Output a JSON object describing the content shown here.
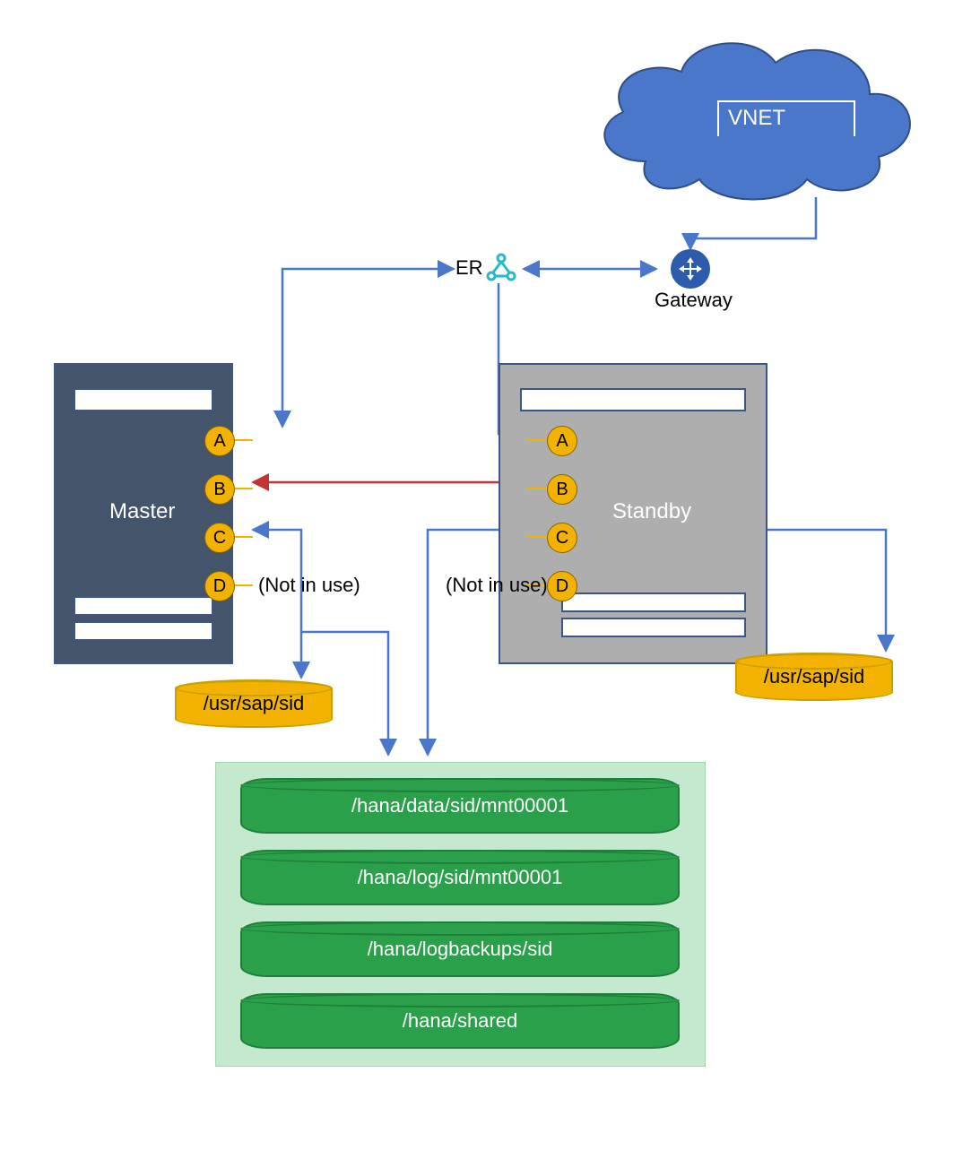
{
  "cloud": {
    "label": "VNET"
  },
  "gateway": {
    "label": "Gateway"
  },
  "er": {
    "label": "ER"
  },
  "master": {
    "label": "Master",
    "ports": {
      "a": "A",
      "b": "B",
      "c": "C",
      "d": "D"
    },
    "not_in_use": "(Not in use)",
    "disk": "/usr/sap/sid"
  },
  "standby": {
    "label": "Standby",
    "ports": {
      "a": "A",
      "b": "B",
      "c": "C",
      "d": "D"
    },
    "not_in_use": "(Not in use)",
    "disk": "/usr/sap/sid"
  },
  "shared_volumes": {
    "v0": "/hana/data/sid/mnt00001",
    "v1": "/hana/log/sid/mnt00001",
    "v2": "/hana/logbackups/sid",
    "v3": "/hana/shared"
  }
}
